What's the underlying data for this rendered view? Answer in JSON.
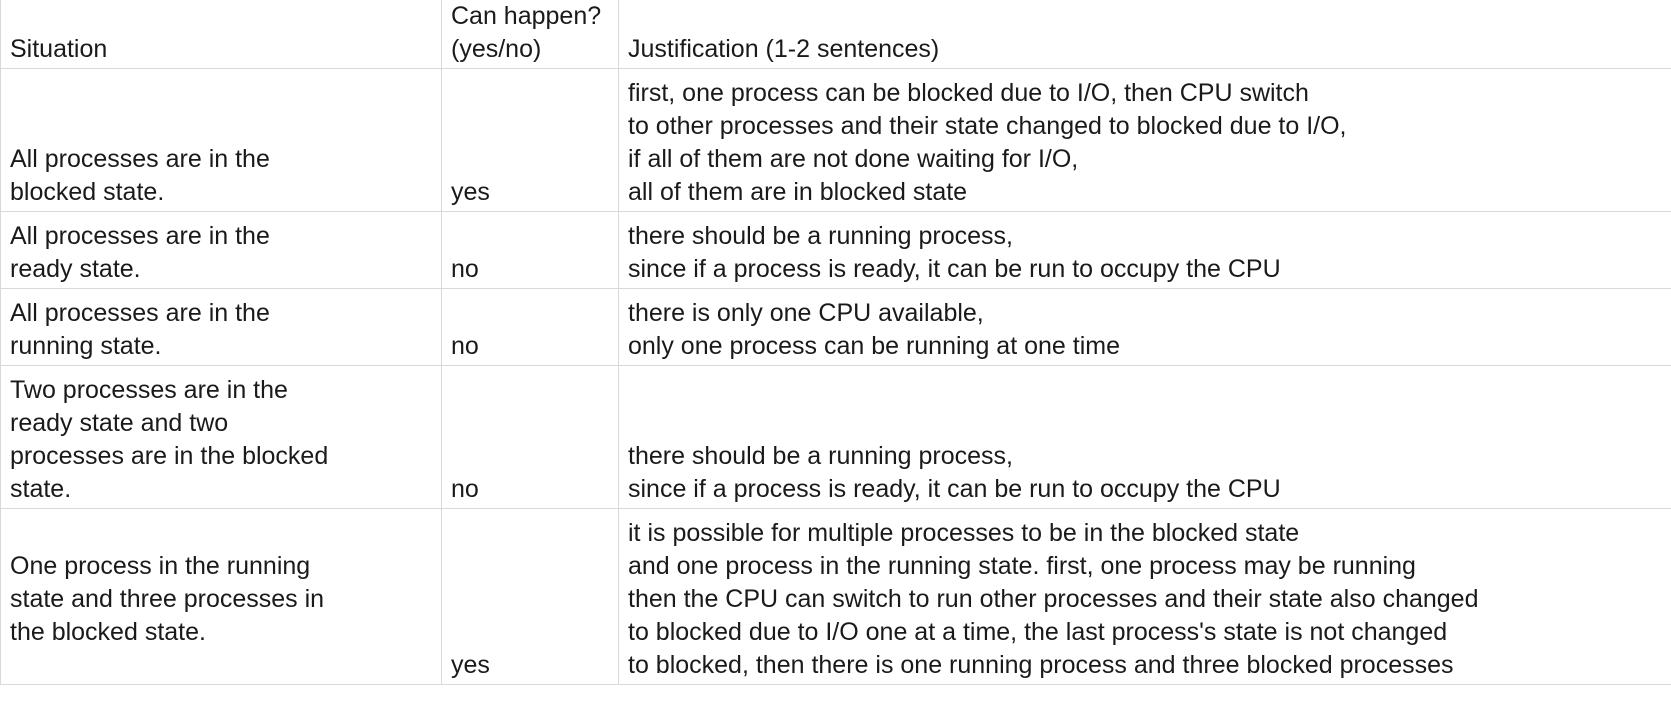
{
  "columns": {
    "situation": "Situation",
    "can_happen_line1": "Can happen?",
    "can_happen_line2": "(yes/no)",
    "justification": "Justification (1-2 sentences)"
  },
  "rows": [
    {
      "situation": [
        "All processes are in the",
        "blocked state."
      ],
      "can_happen": "yes",
      "justification": [
        "first, one process can be blocked due to I/O, then CPU switch",
        "to other processes and their state changed to blocked due to I/O,",
        "if all of them are not done waiting for I/O,",
        "all of them are in blocked state"
      ]
    },
    {
      "situation": [
        "All processes are in the",
        "ready state."
      ],
      "can_happen": "no",
      "justification": [
        "there should be a running process,",
        "since if a process is ready, it can be run to occupy the CPU"
      ]
    },
    {
      "situation": [
        "All processes are in the",
        "running state."
      ],
      "can_happen": "no",
      "justification": [
        "there is only one CPU available,",
        "only one process can be running at one time"
      ]
    },
    {
      "situation": [
        "Two processes are in the",
        "ready state and two",
        "processes are in the blocked",
        "state."
      ],
      "can_happen": "no",
      "justification": [
        "there should be a running process,",
        "since if a process is ready, it can be run to occupy the CPU"
      ]
    },
    {
      "situation": [
        "One process in the running",
        "state and three processes in",
        "the blocked state."
      ],
      "can_happen": "yes",
      "justification": [
        "it is possible for multiple processes to be in the blocked state",
        "and one process in the running state. first, one process may be running",
        "then the CPU can switch to run other processes and their state also changed",
        "to blocked due to I/O one at a time, the last process's state is not changed",
        "to blocked, then there is one running process and three blocked processes"
      ]
    }
  ]
}
